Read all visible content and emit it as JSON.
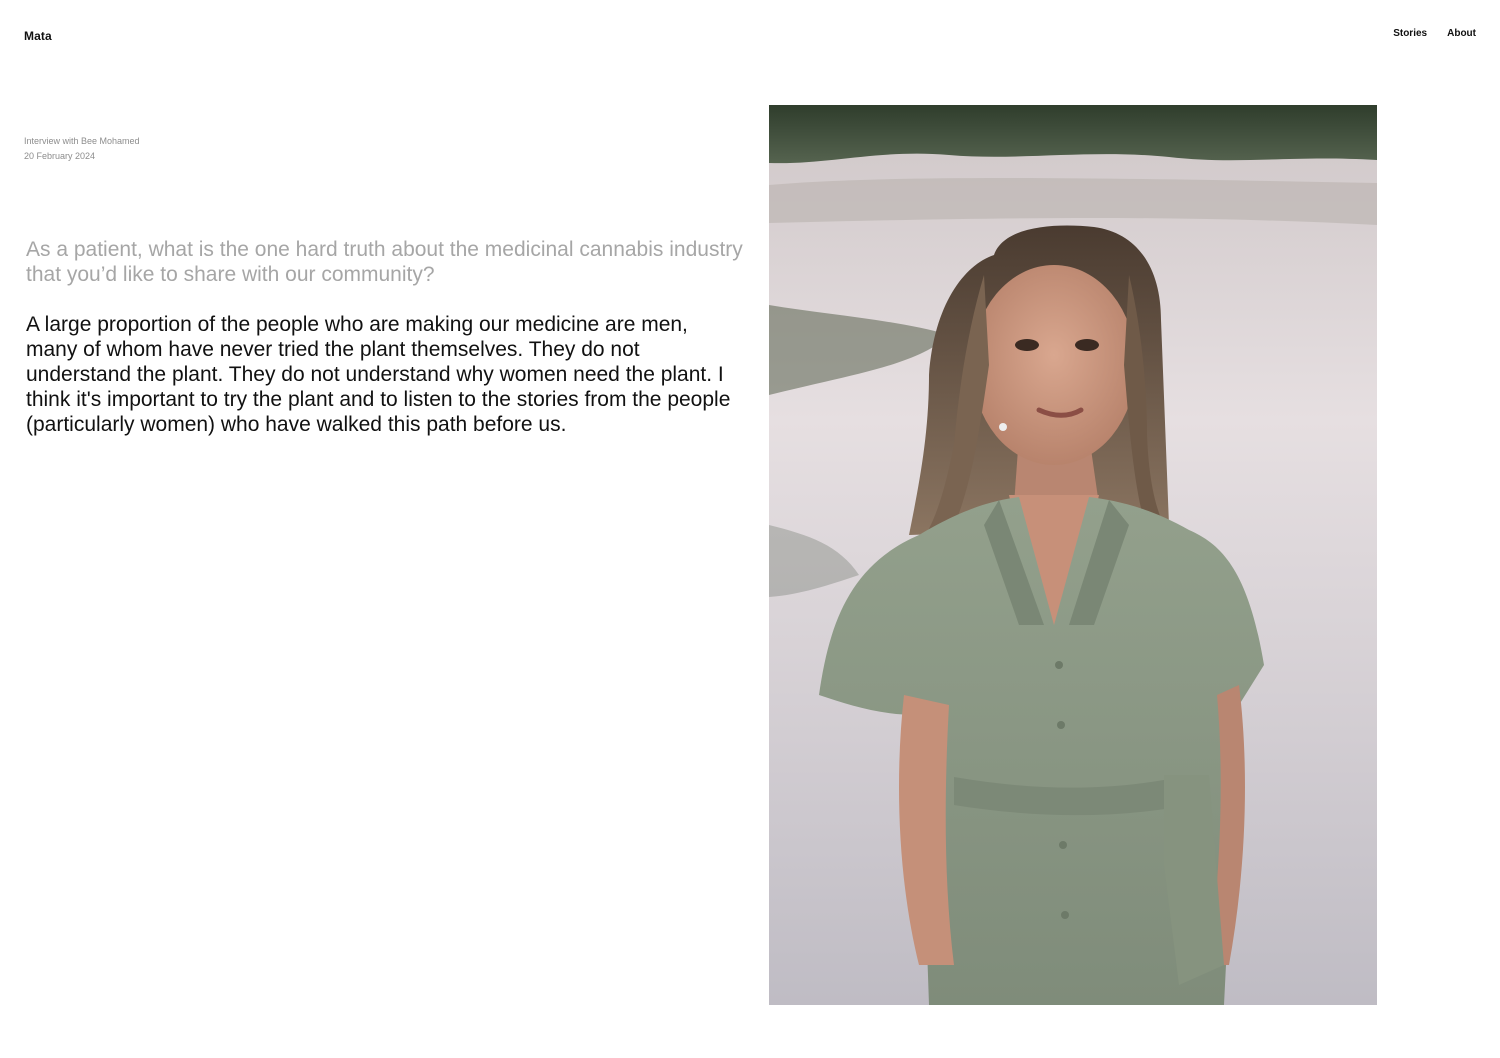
{
  "header": {
    "brand": "Mata",
    "nav": [
      {
        "label": "Stories"
      },
      {
        "label": "About"
      }
    ]
  },
  "article": {
    "meta_title": "Interview with Bee Mohamed",
    "meta_date": "20 February 2024",
    "question": "As a patient, what is the one hard truth about the medicinal cannabis industry that you’d like to share with our community?",
    "answer": "A large proportion of the people who are making our medicine are men, many of whom have never tried the plant themselves. They do not understand the plant. They do not understand why women need the plant. I think it's important to try the plant and to listen to the stories from the people (particularly women) who have walked this path before us."
  },
  "photo": {
    "subject": "portrait of woman in green shirt dress standing by water"
  },
  "colors": {
    "text": "#111111",
    "muted": "#8d8d8d",
    "question": "#a6a6a6",
    "background": "#ffffff"
  }
}
